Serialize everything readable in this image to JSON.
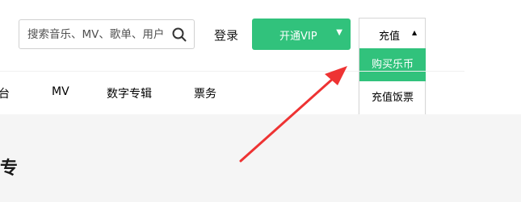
{
  "search": {
    "placeholder": "搜索音乐、MV、歌单、用户",
    "icon": "search-icon"
  },
  "header": {
    "login_label": "登录",
    "vip_label": "开通VIP",
    "recharge_label": "充值"
  },
  "recharge_menu": {
    "items": [
      {
        "label": "购买乐币"
      },
      {
        "label": "充值饭票"
      }
    ]
  },
  "nav": {
    "items": [
      {
        "label": "台"
      },
      {
        "label": "MV"
      },
      {
        "label": "数字专辑"
      },
      {
        "label": "票务"
      }
    ]
  },
  "partial_heading": "专",
  "colors": {
    "accent": "#31c27c",
    "annotation_arrow": "#ee3333"
  }
}
